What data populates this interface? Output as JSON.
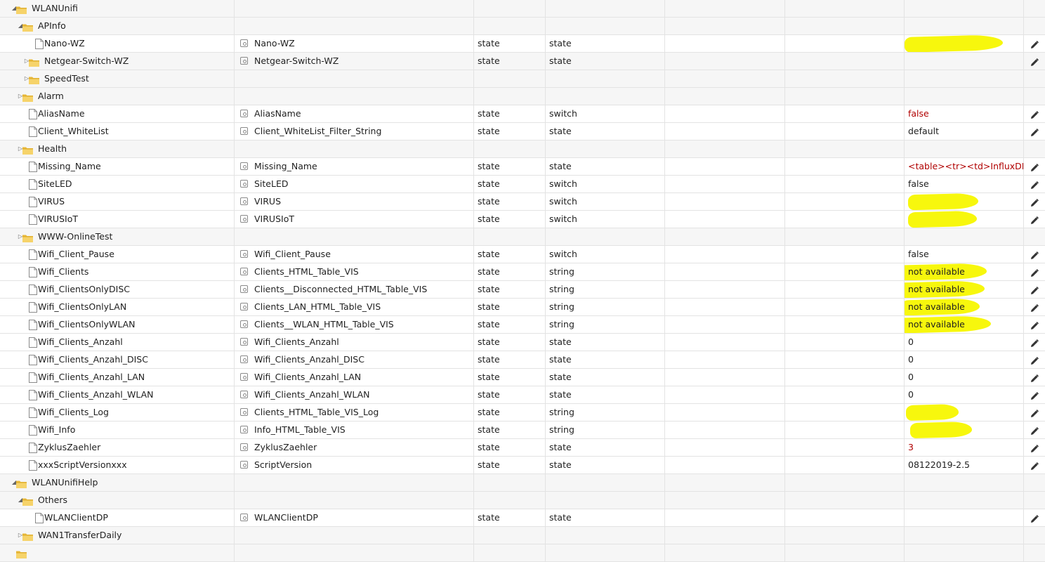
{
  "colors": {
    "folder": "#f2c94c",
    "highlight": "#f7f700",
    "value_red": "#b00000",
    "row_border": "#e3e3e3"
  },
  "rows": [
    {
      "kind": "folder",
      "level": 0,
      "expand": "open",
      "name": "WLANUnifi"
    },
    {
      "kind": "folder",
      "level": 1,
      "expand": "open",
      "name": "APInfo"
    },
    {
      "kind": "state",
      "level": 2,
      "name": "Nano-WZ",
      "common_name": "Nano-WZ",
      "type": "state",
      "role": "state",
      "value": "",
      "highlight": true
    },
    {
      "kind": "folder",
      "level": 2,
      "expand": "closed",
      "name": "Netgear-Switch-WZ",
      "common_name": "Netgear-Switch-WZ",
      "type": "state",
      "role": "state",
      "value": "",
      "has_edit": true
    },
    {
      "kind": "folder",
      "level": 2,
      "expand": "closed",
      "name": "SpeedTest"
    },
    {
      "kind": "folder",
      "level": 1,
      "expand": "closed",
      "name": "Alarm"
    },
    {
      "kind": "state",
      "level": 1,
      "name": "AliasName",
      "common_name": "AliasName",
      "type": "state",
      "role": "switch",
      "value": "false",
      "value_color": "red"
    },
    {
      "kind": "state",
      "level": 1,
      "name": "Client_WhiteList",
      "common_name": "Client_WhiteList_Filter_String",
      "type": "state",
      "role": "state",
      "value": "default"
    },
    {
      "kind": "folder",
      "level": 1,
      "expand": "closed",
      "name": "Health"
    },
    {
      "kind": "state",
      "level": 1,
      "name": "Missing_Name",
      "common_name": "Missing_Name",
      "type": "state",
      "role": "state",
      "value": "<table><tr><td>InfluxDB --",
      "value_color": "red"
    },
    {
      "kind": "state",
      "level": 1,
      "name": "SiteLED",
      "common_name": "SiteLED",
      "type": "state",
      "role": "switch",
      "value": "false"
    },
    {
      "kind": "state",
      "level": 1,
      "name": "VIRUS",
      "common_name": "VIRUS",
      "type": "state",
      "role": "switch",
      "value": "",
      "highlight": true
    },
    {
      "kind": "state",
      "level": 1,
      "name": "VIRUSIoT",
      "common_name": "VIRUSIoT",
      "type": "state",
      "role": "switch",
      "value": "",
      "highlight": true
    },
    {
      "kind": "folder",
      "level": 1,
      "expand": "closed",
      "name": "WWW-OnlineTest"
    },
    {
      "kind": "state",
      "level": 1,
      "name": "Wifi_Client_Pause",
      "common_name": "Wifi_Client_Pause",
      "type": "state",
      "role": "switch",
      "value": "false"
    },
    {
      "kind": "state",
      "level": 1,
      "name": "Wifi_Clients",
      "common_name": "Clients_HTML_Table_VIS",
      "type": "state",
      "role": "string",
      "value": "not available",
      "highlight": true
    },
    {
      "kind": "state",
      "level": 1,
      "name": "Wifi_ClientsOnlyDISC",
      "common_name": "Clients__Disconnected_HTML_Table_VIS",
      "type": "state",
      "role": "string",
      "value": "not available",
      "highlight": true
    },
    {
      "kind": "state",
      "level": 1,
      "name": "Wifi_ClientsOnlyLAN",
      "common_name": "Clients_LAN_HTML_Table_VIS",
      "type": "state",
      "role": "string",
      "value": "not available",
      "highlight": true
    },
    {
      "kind": "state",
      "level": 1,
      "name": "Wifi_ClientsOnlyWLAN",
      "common_name": "Clients__WLAN_HTML_Table_VIS",
      "type": "state",
      "role": "string",
      "value": "not available",
      "highlight": true
    },
    {
      "kind": "state",
      "level": 1,
      "name": "Wifi_Clients_Anzahl",
      "common_name": "Wifi_Clients_Anzahl",
      "type": "state",
      "role": "state",
      "value": "0"
    },
    {
      "kind": "state",
      "level": 1,
      "name": "Wifi_Clients_Anzahl_DISC",
      "common_name": "Wifi_Clients_Anzahl_DISC",
      "type": "state",
      "role": "state",
      "value": "0"
    },
    {
      "kind": "state",
      "level": 1,
      "name": "Wifi_Clients_Anzahl_LAN",
      "common_name": "Wifi_Clients_Anzahl_LAN",
      "type": "state",
      "role": "state",
      "value": "0"
    },
    {
      "kind": "state",
      "level": 1,
      "name": "Wifi_Clients_Anzahl_WLAN",
      "common_name": "Wifi_Clients_Anzahl_WLAN",
      "type": "state",
      "role": "state",
      "value": "0"
    },
    {
      "kind": "state",
      "level": 1,
      "name": "Wifi_Clients_Log",
      "common_name": "Clients_HTML_Table_VIS_Log",
      "type": "state",
      "role": "string",
      "value": "",
      "highlight": true
    },
    {
      "kind": "state",
      "level": 1,
      "name": "Wifi_Info",
      "common_name": "Info_HTML_Table_VIS",
      "type": "state",
      "role": "string",
      "value": "",
      "highlight": true
    },
    {
      "kind": "state",
      "level": 1,
      "name": "ZyklusZaehler",
      "common_name": "ZyklusZaehler",
      "type": "state",
      "role": "state",
      "value": "3",
      "value_color": "red"
    },
    {
      "kind": "state",
      "level": 1,
      "name": "xxxScriptVersionxxx",
      "common_name": "ScriptVersion",
      "type": "state",
      "role": "state",
      "value": "08122019-2.5"
    },
    {
      "kind": "folder",
      "level": 0,
      "expand": "open",
      "name": "WLANUnifiHelp"
    },
    {
      "kind": "folder",
      "level": 1,
      "expand": "open",
      "name": "Others"
    },
    {
      "kind": "state",
      "level": 2,
      "name": "WLANClientDP",
      "common_name": "WLANClientDP",
      "type": "state",
      "role": "state",
      "value": ""
    },
    {
      "kind": "folder",
      "level": 1,
      "expand": "closed",
      "name": "WAN1TransferDaily"
    },
    {
      "kind": "folder",
      "level": 0,
      "expand": "none",
      "name": ""
    }
  ]
}
